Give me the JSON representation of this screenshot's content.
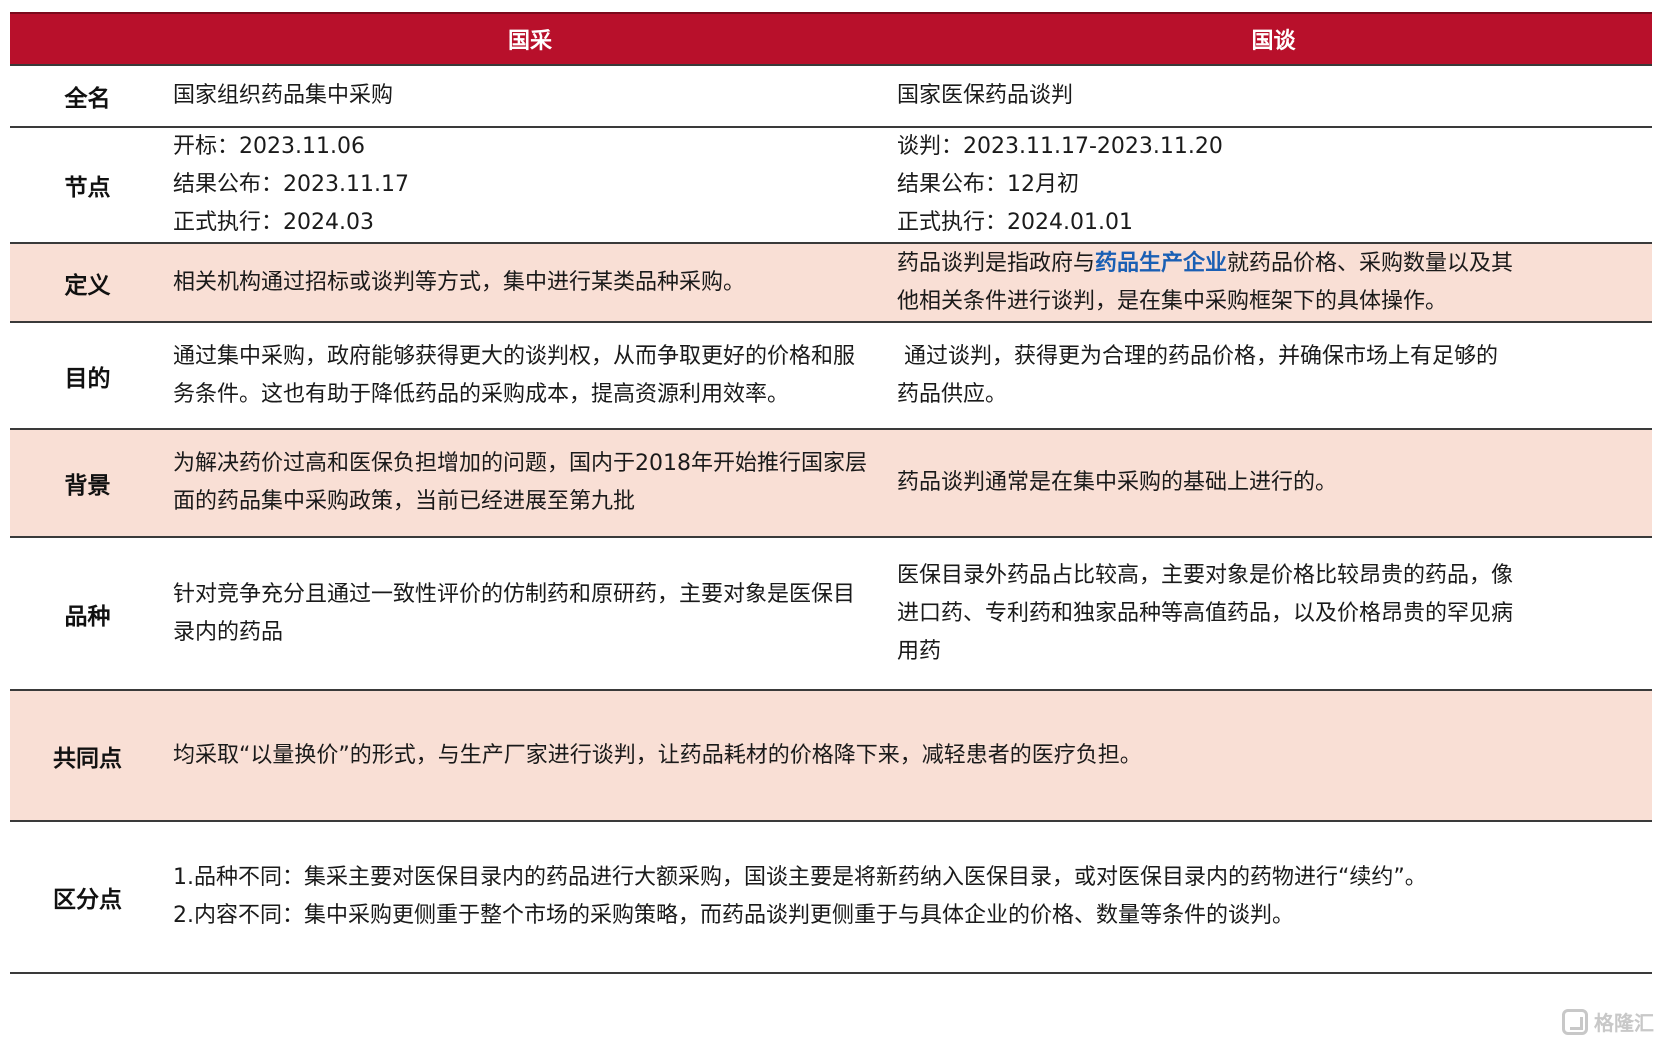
{
  "header": {
    "col1": "国采",
    "col2": "国谈"
  },
  "rows": {
    "fullname": {
      "label": "全名",
      "col1": "国家组织药品集中采购",
      "col2": "国家医保药品谈判"
    },
    "nodes": {
      "label": "节点",
      "col1": [
        "开标：2023.11.06",
        "结果公布：2023.11.17",
        "正式执行：2024.03"
      ],
      "col2": [
        "谈判：2023.11.17-2023.11.20",
        "结果公布：12月初",
        "正式执行：2024.01.01"
      ]
    },
    "definition": {
      "label": "定义",
      "col1": "相关机构通过招标或谈判等方式，集中进行某类品种采购。",
      "col2_pre": "药品谈判是指政府与",
      "col2_highlight": "药品生产企业",
      "col2_post1": "就药品价格、采购数量以及其",
      "col2_post2": "他相关条件进行谈判，是在集中采购框架下的具体操作。"
    },
    "purpose": {
      "label": "目的",
      "col1": [
        "通过集中采购，政府能够获得更大的谈判权，从而争取更好的价格和服",
        "务条件。这也有助于降低药品的采购成本，提高资源利用效率。"
      ],
      "col2": [
        " 通过谈判，获得更为合理的药品价格，并确保市场上有足够的",
        "药品供应。"
      ]
    },
    "background": {
      "label": "背景",
      "col1": [
        "为解决药价过高和医保负担增加的问题，国内于2018年开始推行国家层",
        "面的药品集中采购政策，当前已经进展至第九批"
      ],
      "col2": "药品谈判通常是在集中采购的基础上进行的。"
    },
    "variety": {
      "label": "品种",
      "col1": [
        "针对竞争充分且通过一致性评价的仿制药和原研药，主要对象是医保目",
        "录内的药品"
      ],
      "col2": [
        "医保目录外药品占比较高，主要对象是价格比较昂贵的药品，像",
        "进口药、专利药和独家品种等高值药品，以及价格昂贵的罕见病",
        "用药"
      ]
    },
    "common": {
      "label": "共同点",
      "text": "均采取“以量换价”的形式，与生产厂家进行谈判，让药品耗材的价格降下来，减轻患者的医疗负担。"
    },
    "difference": {
      "label": "区分点",
      "lines": [
        "1.品种不同：集采主要对医保目录内的药品进行大额采购，国谈主要是将新药纳入医保目录，或对医保目录内的药物进行“续约”。",
        "2.内容不同：集中采购更侧重于整个市场的采购策略，而药品谈判更侧重于与具体企业的价格、数量等条件的谈判。"
      ]
    }
  },
  "watermark": {
    "text": "格隆汇"
  }
}
